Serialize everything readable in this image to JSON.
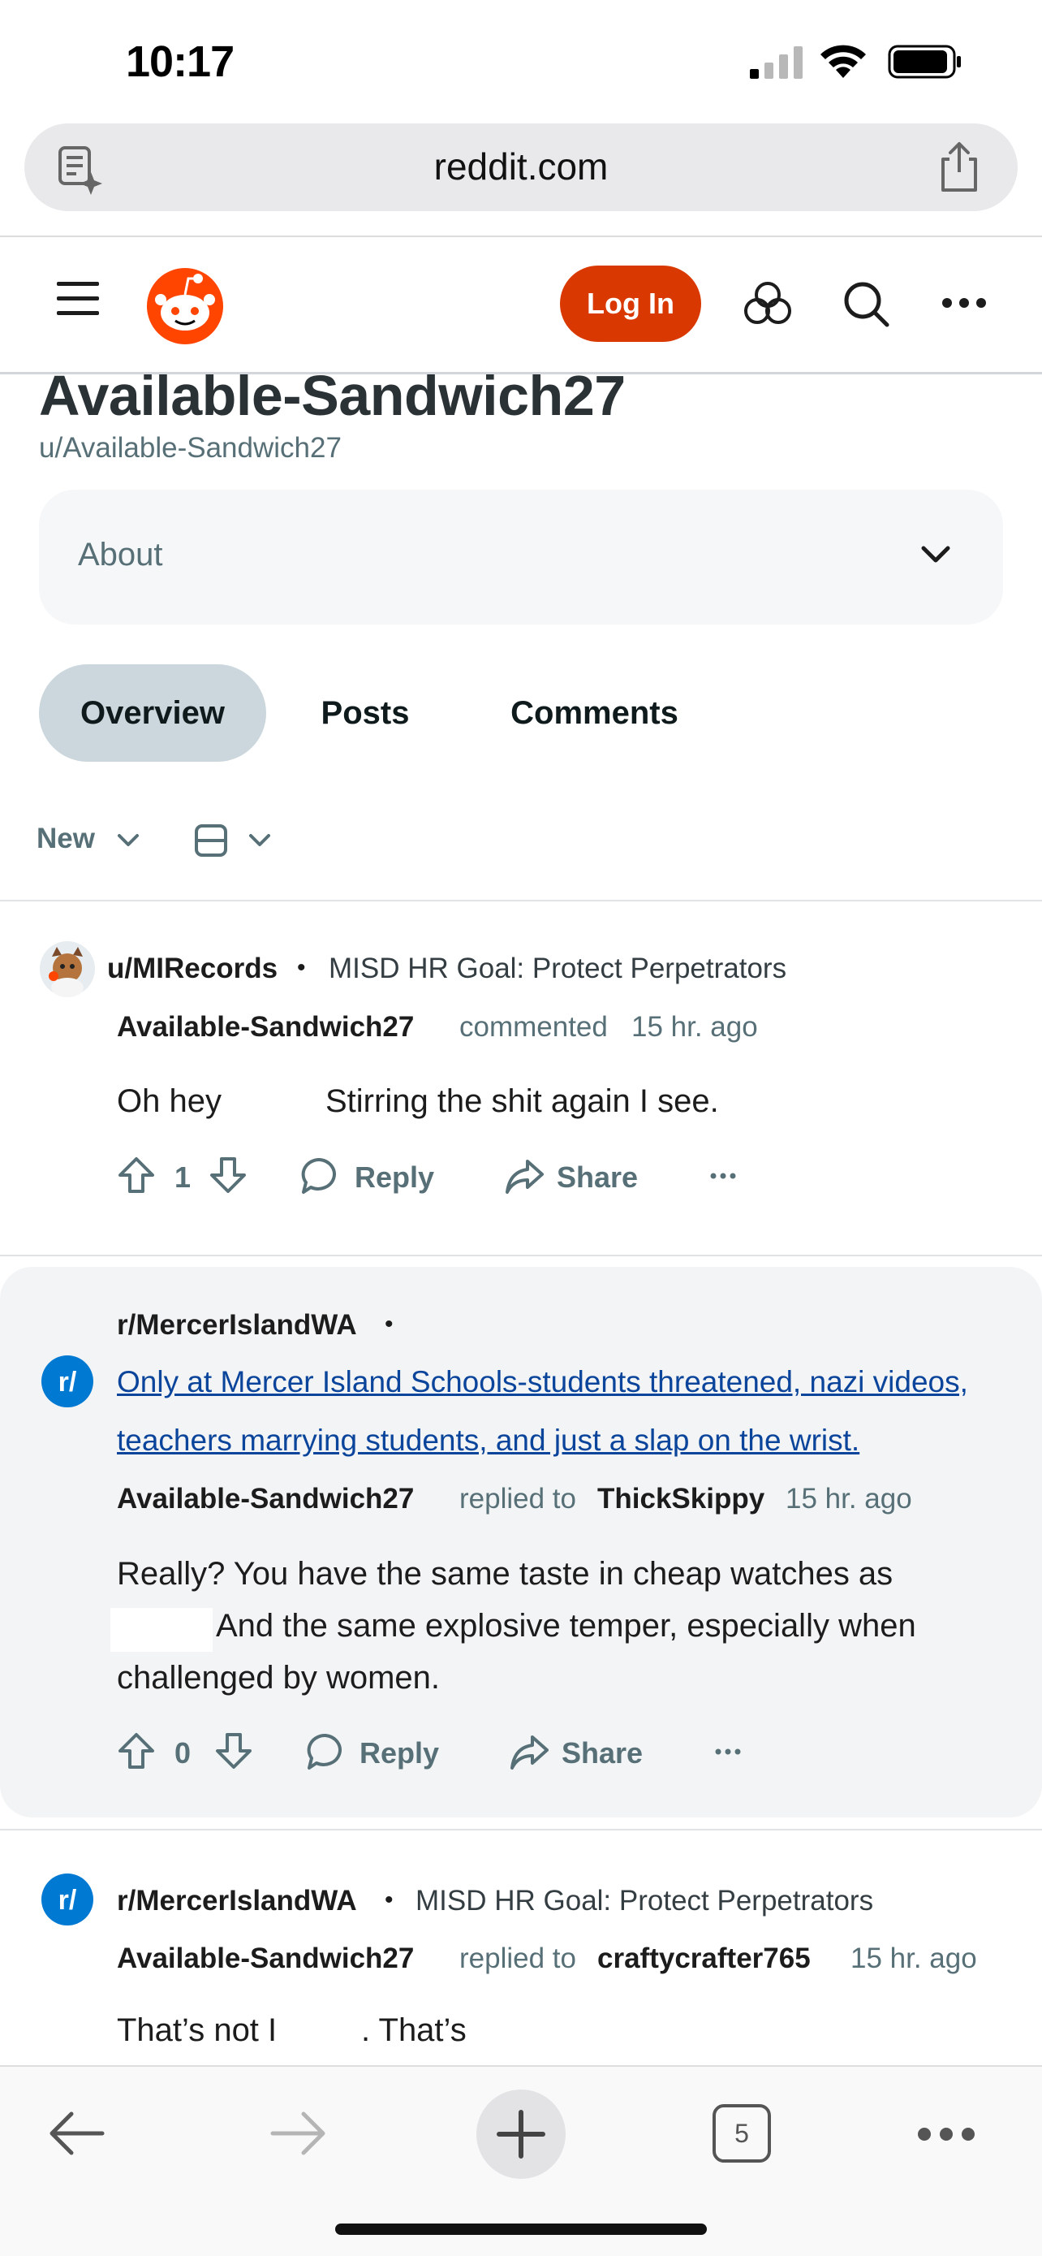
{
  "status_bar": {
    "time": "10:17"
  },
  "browser": {
    "url": "reddit.com",
    "tab_count": "5"
  },
  "header": {
    "login_label": "Log In"
  },
  "profile": {
    "display_name": "Available-Sandwich27",
    "handle": "u/Available-Sandwich27",
    "about_label": "About"
  },
  "tabs": [
    {
      "label": "Overview",
      "active": true
    },
    {
      "label": "Posts",
      "active": false
    },
    {
      "label": "Comments",
      "active": false
    }
  ],
  "sort": {
    "label": "New"
  },
  "feed": [
    {
      "source": "u/MIRecords",
      "post_title": "MISD HR Goal: Protect Perpetrators",
      "author": "Available-Sandwich27",
      "action": "commented",
      "time": "15 hr. ago",
      "body_1": "Oh hey",
      "body_2": "Stirring the shit again I see.",
      "score": "1",
      "reply_label": "Reply",
      "share_label": "Share"
    },
    {
      "source": "r/MercerIslandWA",
      "link_line_1": "Only at Mercer Island Schools-students threatened, nazi videos,",
      "link_line_2": "teachers marrying students, and just a slap on the wrist.",
      "author": "Available-Sandwich27",
      "action": "replied to",
      "replied_to": "ThickSkippy",
      "time": "15 hr. ago",
      "body_line_1": "Really? You have the same taste in cheap watches as",
      "body_line_2": "And the same explosive temper, especially when",
      "body_line_3": "challenged by women.",
      "score": "0",
      "reply_label": "Reply",
      "share_label": "Share"
    },
    {
      "source": "r/MercerIslandWA",
      "post_title": "MISD HR Goal: Protect Perpetrators",
      "author": "Available-Sandwich27",
      "action": "replied to",
      "replied_to": "craftycrafter765",
      "time": "15 hr. ago",
      "body_1": "That’s not I",
      "body_2": ". That’s"
    }
  ],
  "colors": {
    "reddit_orange": "#d93900",
    "subreddit_blue": "#0079d3",
    "link_blue": "#0a449b",
    "tab_active_bg": "#cbd7dd"
  }
}
